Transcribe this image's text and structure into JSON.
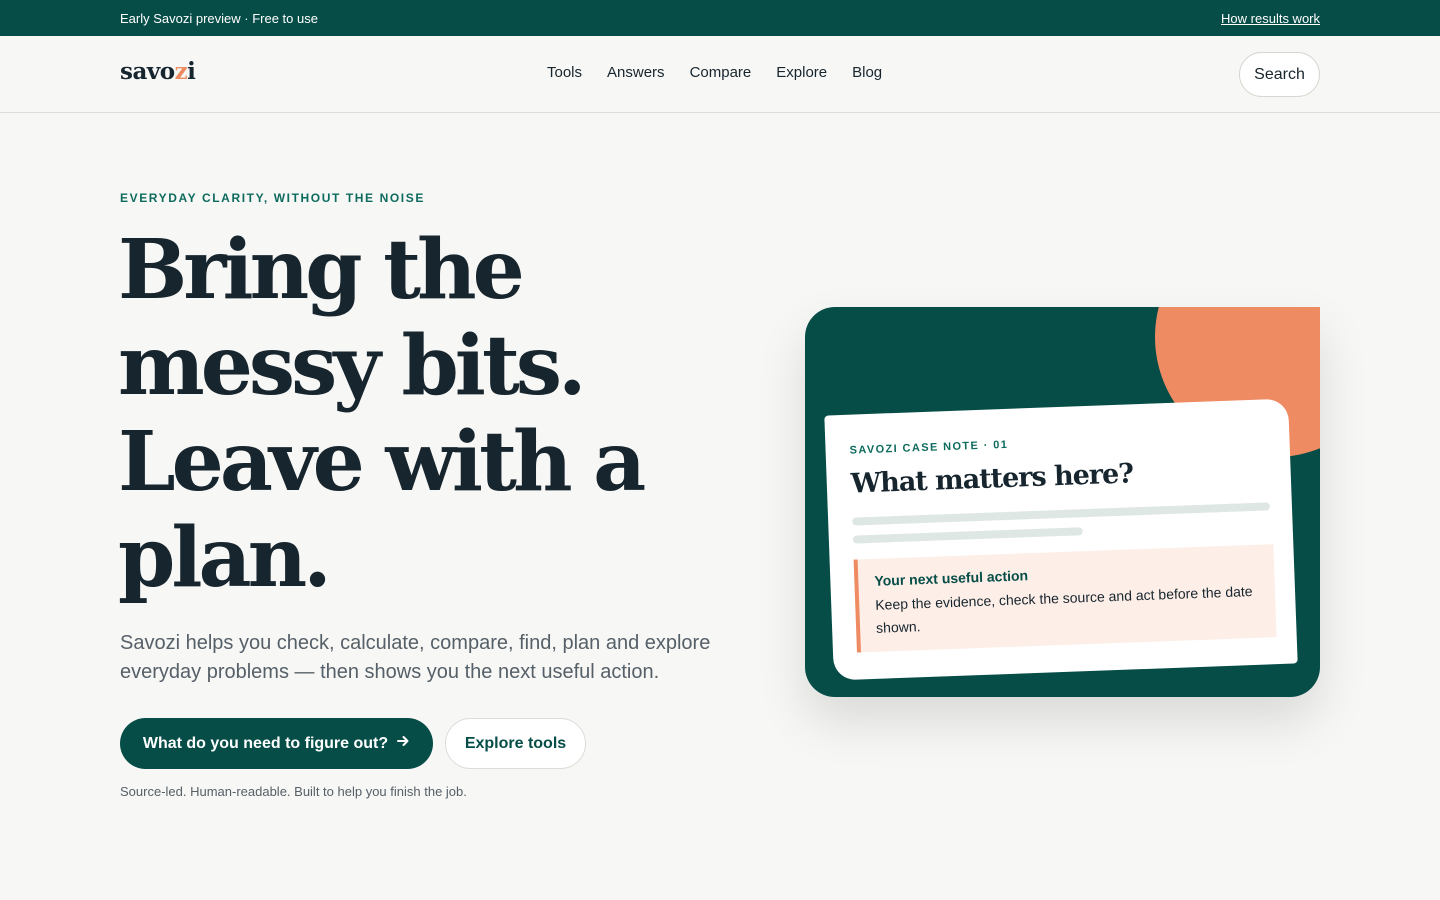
{
  "topbar": {
    "announcement": "Early Savozi preview · Free to use",
    "link": "How results work"
  },
  "header": {
    "logo_main": "savo",
    "logo_accent": "z",
    "logo_end": "i",
    "nav": [
      "Tools",
      "Answers",
      "Compare",
      "Explore",
      "Blog"
    ],
    "search_label": "Search"
  },
  "hero": {
    "eyebrow": "EVERYDAY CLARITY, WITHOUT THE NOISE",
    "headline": "Bring the messy bits. Leave with a plan.",
    "lead": "Savozi helps you check, calculate, compare, find, plan and explore everyday problems — then shows you the next useful action.",
    "primary_cta": "What do you need to figure out?",
    "primary_cta_icon": "arrow-right-icon",
    "secondary_cta": "Explore tools",
    "footnote": "Source-led. Human-readable. Built to help you finish the job."
  },
  "case_card": {
    "eyebrow": "SAVOZI CASE NOTE · 01",
    "title": "What matters here?",
    "action_title": "Your next useful action",
    "action_text": "Keep the evidence, check the source and act before the date shown."
  },
  "colors": {
    "brand_green": "#064d48",
    "accent_orange": "#ef8b63",
    "background": "#f7f7f5"
  }
}
